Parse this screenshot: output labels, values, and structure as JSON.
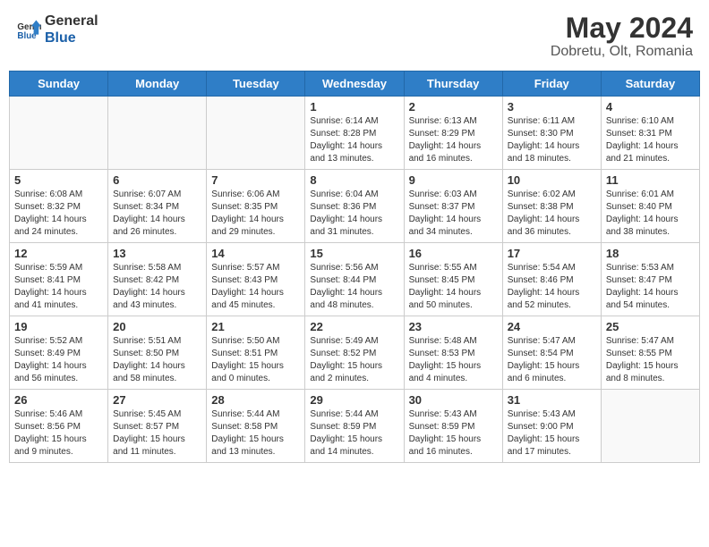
{
  "header": {
    "logo_line1": "General",
    "logo_line2": "Blue",
    "month": "May 2024",
    "location": "Dobretu, Olt, Romania"
  },
  "weekdays": [
    "Sunday",
    "Monday",
    "Tuesday",
    "Wednesday",
    "Thursday",
    "Friday",
    "Saturday"
  ],
  "weeks": [
    [
      {
        "day": "",
        "info": ""
      },
      {
        "day": "",
        "info": ""
      },
      {
        "day": "",
        "info": ""
      },
      {
        "day": "1",
        "info": "Sunrise: 6:14 AM\nSunset: 8:28 PM\nDaylight: 14 hours\nand 13 minutes."
      },
      {
        "day": "2",
        "info": "Sunrise: 6:13 AM\nSunset: 8:29 PM\nDaylight: 14 hours\nand 16 minutes."
      },
      {
        "day": "3",
        "info": "Sunrise: 6:11 AM\nSunset: 8:30 PM\nDaylight: 14 hours\nand 18 minutes."
      },
      {
        "day": "4",
        "info": "Sunrise: 6:10 AM\nSunset: 8:31 PM\nDaylight: 14 hours\nand 21 minutes."
      }
    ],
    [
      {
        "day": "5",
        "info": "Sunrise: 6:08 AM\nSunset: 8:32 PM\nDaylight: 14 hours\nand 24 minutes."
      },
      {
        "day": "6",
        "info": "Sunrise: 6:07 AM\nSunset: 8:34 PM\nDaylight: 14 hours\nand 26 minutes."
      },
      {
        "day": "7",
        "info": "Sunrise: 6:06 AM\nSunset: 8:35 PM\nDaylight: 14 hours\nand 29 minutes."
      },
      {
        "day": "8",
        "info": "Sunrise: 6:04 AM\nSunset: 8:36 PM\nDaylight: 14 hours\nand 31 minutes."
      },
      {
        "day": "9",
        "info": "Sunrise: 6:03 AM\nSunset: 8:37 PM\nDaylight: 14 hours\nand 34 minutes."
      },
      {
        "day": "10",
        "info": "Sunrise: 6:02 AM\nSunset: 8:38 PM\nDaylight: 14 hours\nand 36 minutes."
      },
      {
        "day": "11",
        "info": "Sunrise: 6:01 AM\nSunset: 8:40 PM\nDaylight: 14 hours\nand 38 minutes."
      }
    ],
    [
      {
        "day": "12",
        "info": "Sunrise: 5:59 AM\nSunset: 8:41 PM\nDaylight: 14 hours\nand 41 minutes."
      },
      {
        "day": "13",
        "info": "Sunrise: 5:58 AM\nSunset: 8:42 PM\nDaylight: 14 hours\nand 43 minutes."
      },
      {
        "day": "14",
        "info": "Sunrise: 5:57 AM\nSunset: 8:43 PM\nDaylight: 14 hours\nand 45 minutes."
      },
      {
        "day": "15",
        "info": "Sunrise: 5:56 AM\nSunset: 8:44 PM\nDaylight: 14 hours\nand 48 minutes."
      },
      {
        "day": "16",
        "info": "Sunrise: 5:55 AM\nSunset: 8:45 PM\nDaylight: 14 hours\nand 50 minutes."
      },
      {
        "day": "17",
        "info": "Sunrise: 5:54 AM\nSunset: 8:46 PM\nDaylight: 14 hours\nand 52 minutes."
      },
      {
        "day": "18",
        "info": "Sunrise: 5:53 AM\nSunset: 8:47 PM\nDaylight: 14 hours\nand 54 minutes."
      }
    ],
    [
      {
        "day": "19",
        "info": "Sunrise: 5:52 AM\nSunset: 8:49 PM\nDaylight: 14 hours\nand 56 minutes."
      },
      {
        "day": "20",
        "info": "Sunrise: 5:51 AM\nSunset: 8:50 PM\nDaylight: 14 hours\nand 58 minutes."
      },
      {
        "day": "21",
        "info": "Sunrise: 5:50 AM\nSunset: 8:51 PM\nDaylight: 15 hours\nand 0 minutes."
      },
      {
        "day": "22",
        "info": "Sunrise: 5:49 AM\nSunset: 8:52 PM\nDaylight: 15 hours\nand 2 minutes."
      },
      {
        "day": "23",
        "info": "Sunrise: 5:48 AM\nSunset: 8:53 PM\nDaylight: 15 hours\nand 4 minutes."
      },
      {
        "day": "24",
        "info": "Sunrise: 5:47 AM\nSunset: 8:54 PM\nDaylight: 15 hours\nand 6 minutes."
      },
      {
        "day": "25",
        "info": "Sunrise: 5:47 AM\nSunset: 8:55 PM\nDaylight: 15 hours\nand 8 minutes."
      }
    ],
    [
      {
        "day": "26",
        "info": "Sunrise: 5:46 AM\nSunset: 8:56 PM\nDaylight: 15 hours\nand 9 minutes."
      },
      {
        "day": "27",
        "info": "Sunrise: 5:45 AM\nSunset: 8:57 PM\nDaylight: 15 hours\nand 11 minutes."
      },
      {
        "day": "28",
        "info": "Sunrise: 5:44 AM\nSunset: 8:58 PM\nDaylight: 15 hours\nand 13 minutes."
      },
      {
        "day": "29",
        "info": "Sunrise: 5:44 AM\nSunset: 8:59 PM\nDaylight: 15 hours\nand 14 minutes."
      },
      {
        "day": "30",
        "info": "Sunrise: 5:43 AM\nSunset: 8:59 PM\nDaylight: 15 hours\nand 16 minutes."
      },
      {
        "day": "31",
        "info": "Sunrise: 5:43 AM\nSunset: 9:00 PM\nDaylight: 15 hours\nand 17 minutes."
      },
      {
        "day": "",
        "info": ""
      }
    ]
  ]
}
